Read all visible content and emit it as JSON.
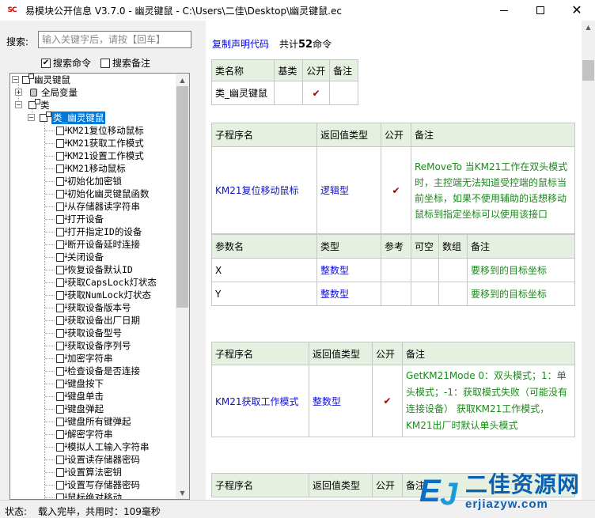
{
  "window": {
    "app_icon_text": "SC",
    "title": "易模块公开信息 V3.7.0 - 幽灵键鼠 - C:\\Users\\二佳\\Desktop\\幽灵键鼠.ec"
  },
  "search": {
    "label": "搜索:",
    "placeholder": "输入关键字后，请按【回车】",
    "value": "",
    "search_commands_label": "搜索命令",
    "search_commands_checked": true,
    "search_notes_label": "搜索备注",
    "search_notes_checked": false
  },
  "tree": {
    "root": "幽灵键鼠",
    "global_vars": "全局变量",
    "classes": "类",
    "class_node": "类_幽灵键鼠",
    "methods": [
      "KM21复位移动鼠标",
      "KM21获取工作模式",
      "KM21设置工作模式",
      "KM21移动鼠标",
      "初始化加密锁",
      "初始化幽灵键鼠函数",
      "从存储器读字符串",
      "打开设备",
      "打开指定ID的设备",
      "断开设备延时连接",
      "关闭设备",
      "恢复设备默认ID",
      "获取CapsLock灯状态",
      "获取NumLock灯状态",
      "获取设备版本号",
      "获取设备出厂日期",
      "获取设备型号",
      "获取设备序列号",
      "加密字符串",
      "检查设备是否连接",
      "键盘按下",
      "键盘单击",
      "键盘弹起",
      "键盘所有键弹起",
      "解密字符串",
      "模拟人工输入字符串",
      "设置读存储器密码",
      "设置算法密钥",
      "设置写存储器密码",
      "鼠标绝对移动"
    ]
  },
  "content": {
    "copy_link": "复制声明代码",
    "count_prefix": "共计",
    "count_value": "52",
    "count_suffix": "命令",
    "class_table": {
      "headers": [
        "类名称",
        "基类",
        "公开",
        "备注"
      ],
      "row": {
        "name": "类_幽灵键鼠",
        "base": "",
        "public": "✔",
        "note": ""
      }
    },
    "sub_headers": [
      "子程序名",
      "返回值类型",
      "公开",
      "备注"
    ],
    "param_headers": [
      "参数名",
      "类型",
      "参考",
      "可空",
      "数组",
      "备注"
    ],
    "subs": [
      {
        "name": "KM21复位移动鼠标",
        "return_type": "逻辑型",
        "public": "✔",
        "note": "ReMoveTo 当KM21工作在双头模式时，主控端无法知道受控端的鼠标当前坐标，如果不使用辅助的话想移动鼠标到指定坐标可以使用该接口",
        "params": [
          {
            "name": "X",
            "type": "整数型",
            "ref": "",
            "nullable": "",
            "array": "",
            "note": "要移到的目标坐标"
          },
          {
            "name": "Y",
            "type": "整数型",
            "ref": "",
            "nullable": "",
            "array": "",
            "note": "要移到的目标坐标"
          }
        ]
      },
      {
        "name": "KM21获取工作模式",
        "return_type": "整数型",
        "public": "✔",
        "note": "GetKM21Mode 0：双头模式；1：单头模式；-1：获取模式失败（可能没有连接设备） 获取KM21工作模式，KM21出厂时默认单头模式"
      }
    ]
  },
  "status": {
    "label": "状态:",
    "text": "载入完毕，共用时：109毫秒"
  },
  "watermark": {
    "logo": "EJ",
    "text": "二佳资源网",
    "url": "erjiazyw.com"
  }
}
